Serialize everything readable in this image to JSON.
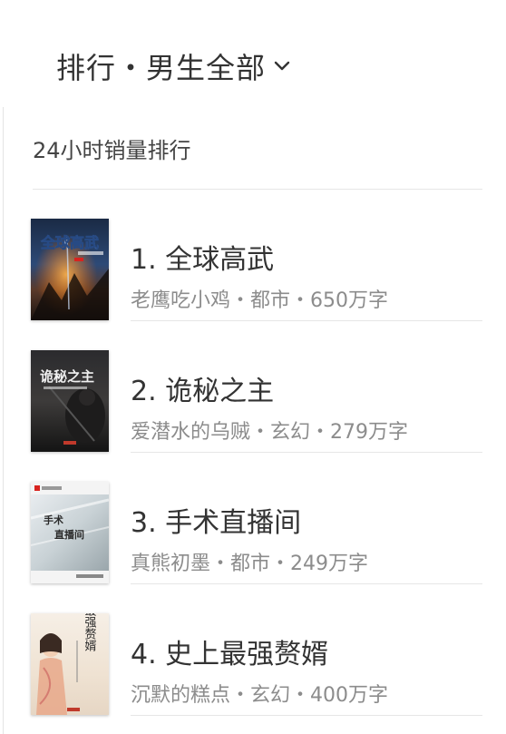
{
  "header": {
    "title": "排行・男生全部"
  },
  "section": {
    "title": "24小时销量排行"
  },
  "books": [
    {
      "title": "1. 全球高武",
      "meta": "老鹰吃小鸡・都市・650万字",
      "cover_text": "全球高武"
    },
    {
      "title": "2. 诡秘之主",
      "meta": "爱潜水的乌贼・玄幻・279万字",
      "cover_text": "诡秘之主"
    },
    {
      "title": "3. 手术直播间",
      "meta": "真熊初墨・都市・249万字",
      "cover_text_1": "手术",
      "cover_text_2": "直播间"
    },
    {
      "title": "4. 史上最强赘婿",
      "meta": "沉默的糕点・玄幻・400万字",
      "cover_text": "最强赘婿"
    }
  ],
  "colors": {
    "title_text": "#333333",
    "meta_text": "#8c8c8c",
    "divider": "#e6e6e6"
  }
}
